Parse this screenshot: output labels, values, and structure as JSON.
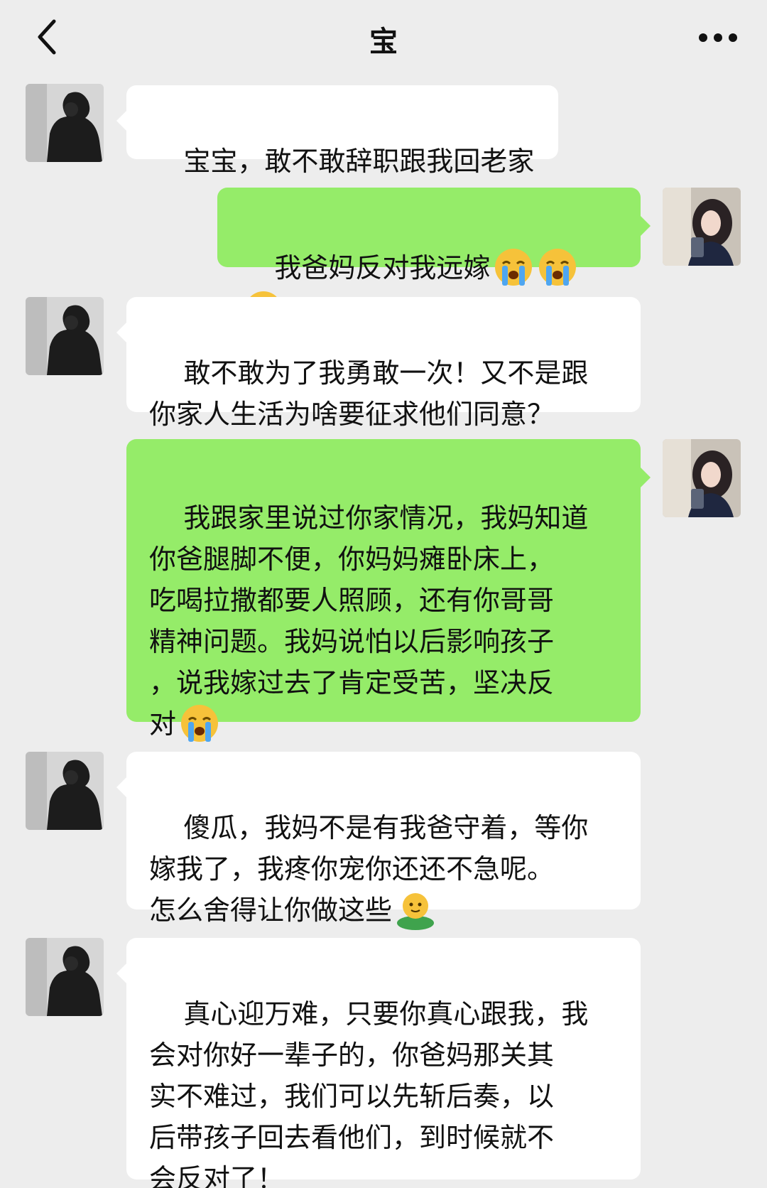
{
  "header": {
    "title": "宝",
    "back_icon": "chevron-left-icon",
    "more_icon": "more-dots-icon"
  },
  "messages": [
    {
      "sender": "other",
      "text": "宝宝，敢不敢辞职跟我回老家",
      "emoji_count": 0
    },
    {
      "sender": "me",
      "text": "我爸妈反对我远嫁",
      "emoji": "crying-face",
      "emoji_count": 3
    },
    {
      "sender": "other",
      "text": "敢不敢为了我勇敢一次！又不是跟\n你家人生活为啥要征求他们同意？",
      "emoji_count": 0
    },
    {
      "sender": "me",
      "text": "我跟家里说过你家情况，我妈知道\n你爸腿脚不便，你妈妈瘫卧床上，\n吃喝拉撒都要人照顾，还有你哥哥\n精神问题。我妈说怕以后影响孩子\n，说我嫁过去了肯定受苦，坚决反\n对",
      "emoji": "crying-face",
      "emoji_count": 1
    },
    {
      "sender": "other",
      "text": "傻瓜，我妈不是有我爸守着，等你\n嫁我了，我疼你宠你还还不急呢。\n怎么舍得让你做这些",
      "emoji": "smiley-hug",
      "emoji_count": 1
    },
    {
      "sender": "other",
      "text": "真心迎万难，只要你真心跟我，我\n会对你好一辈子的，你爸妈那关其\n实不难过，我们可以先斩后奏，以\n后带孩子回去看他们，到时候就不\n会反对了！",
      "emoji_count": 0
    }
  ],
  "colors": {
    "background": "#ededed",
    "incoming_bubble": "#ffffff",
    "outgoing_bubble": "#95ec69"
  }
}
